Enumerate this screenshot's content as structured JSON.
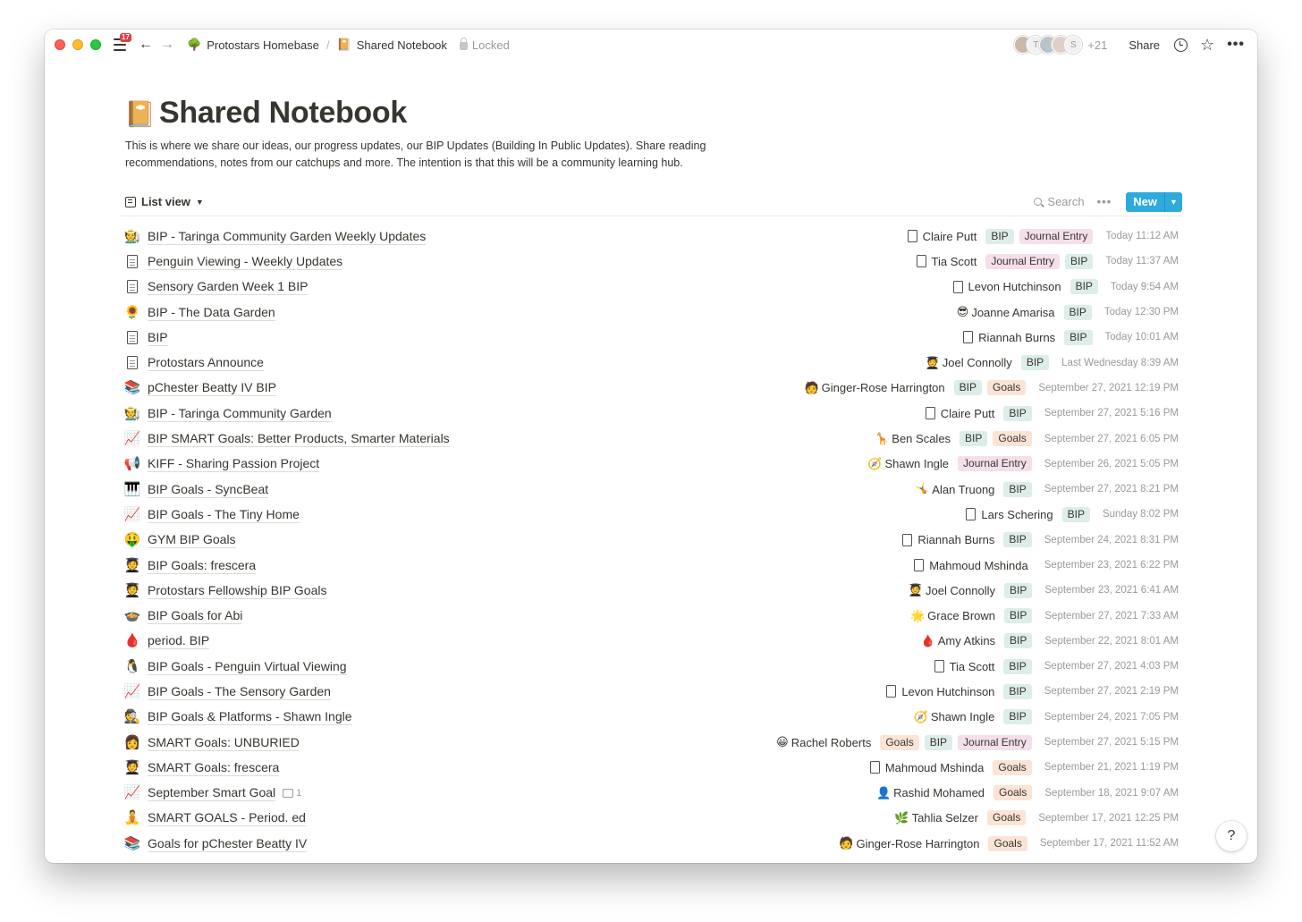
{
  "window": {
    "notification_count": "17",
    "breadcrumb": [
      {
        "icon": "🌳",
        "label": "Protostars Homebase"
      },
      {
        "icon": "📔",
        "label": "Shared Notebook"
      }
    ],
    "locked_label": "Locked",
    "avatar_letters": [
      "T",
      "S"
    ],
    "more_collaborators": "+21",
    "share_label": "Share",
    "help_label": "?"
  },
  "page": {
    "icon": "📔",
    "title": "Shared Notebook",
    "description": "This is where we share our ideas, our progress updates, our BIP Updates (Building In Public Updates). Share reading recommendations, notes from our catchups and more. The intention is that this will be a community learning hub."
  },
  "view": {
    "label": "List view",
    "search_label": "Search",
    "new_label": "New"
  },
  "rows": [
    {
      "icon": "🧑‍🌾",
      "title": "BIP - Taringa Community Garden Weekly Updates",
      "person_icon": "doc",
      "person": "Claire Putt",
      "tags": [
        "BIP",
        "Journal Entry"
      ],
      "date": "Today 11:12 AM"
    },
    {
      "icon": "doc",
      "title": "Penguin Viewing - Weekly Updates",
      "person_icon": "doc",
      "person": "Tia Scott",
      "tags": [
        "Journal Entry",
        "BIP"
      ],
      "date": "Today 11:37 AM"
    },
    {
      "icon": "doc",
      "title": "Sensory Garden Week 1 BIP",
      "person_icon": "doc",
      "person": "Levon Hutchinson",
      "tags": [
        "BIP"
      ],
      "date": "Today 9:54 AM"
    },
    {
      "icon": "🌻",
      "title": "BIP - The Data Garden",
      "person_icon": "😎",
      "person": "Joanne Amarisa",
      "tags": [
        "BIP"
      ],
      "date": "Today 12:30 PM"
    },
    {
      "icon": "doc",
      "title": "BIP",
      "person_icon": "doc",
      "person": "Riannah Burns",
      "tags": [
        "BIP"
      ],
      "date": "Today 10:01 AM"
    },
    {
      "icon": "doc",
      "title": "Protostars Announce",
      "person_icon": "🧑‍🎓",
      "person": "Joel Connolly",
      "tags": [
        "BIP"
      ],
      "date": "Last Wednesday 8:39 AM"
    },
    {
      "icon": "📚",
      "title": "pChester Beatty IV BIP",
      "person_icon": "🧑",
      "person": "Ginger-Rose Harrington",
      "tags": [
        "BIP",
        "Goals"
      ],
      "date": "September 27, 2021 12:19 PM"
    },
    {
      "icon": "🧑‍🌾",
      "title": "BIP - Taringa Community Garden",
      "person_icon": "doc",
      "person": "Claire Putt",
      "tags": [
        "BIP"
      ],
      "date": "September 27, 2021 5:16 PM"
    },
    {
      "icon": "📈",
      "title": "BIP SMART Goals: Better Products, Smarter Materials",
      "person_icon": "🦒",
      "person": "Ben Scales",
      "tags": [
        "BIP",
        "Goals"
      ],
      "date": "September 27, 2021 6:05 PM"
    },
    {
      "icon": "📢",
      "title": "KIFF - Sharing Passion Project",
      "person_icon": "🧭",
      "person": "Shawn Ingle",
      "tags": [
        "Journal Entry"
      ],
      "date": "September 26, 2021 5:05 PM"
    },
    {
      "icon": "🎹",
      "title": "BIP Goals - SyncBeat",
      "person_icon": "🤸",
      "person": "Alan Truong",
      "tags": [
        "BIP"
      ],
      "date": "September 27, 2021 8:21 PM"
    },
    {
      "icon": "📈",
      "title": "BIP Goals - The Tiny Home",
      "person_icon": "doc",
      "person": "Lars Schering",
      "tags": [
        "BIP"
      ],
      "date": "Sunday 8:02 PM"
    },
    {
      "icon": "🤑",
      "title": "GYM BIP Goals",
      "person_icon": "doc",
      "person": "Riannah Burns",
      "tags": [
        "BIP"
      ],
      "date": "September 24, 2021 8:31 PM"
    },
    {
      "icon": "🧑‍🎓",
      "title": "BIP Goals: frescera",
      "person_icon": "doc",
      "person": "Mahmoud Mshinda",
      "tags": [],
      "date": "September 23, 2021 6:22 PM"
    },
    {
      "icon": "🧑‍🎓",
      "title": "Protostars Fellowship BIP Goals",
      "person_icon": "🧑‍🎓",
      "person": "Joel Connolly",
      "tags": [
        "BIP"
      ],
      "date": "September 23, 2021 6:41 AM"
    },
    {
      "icon": "🍲",
      "title": "BIP Goals for Abi",
      "person_icon": "🌟",
      "person": "Grace Brown",
      "tags": [
        "BIP"
      ],
      "date": "September 27, 2021 7:33 AM"
    },
    {
      "icon": "🩸",
      "title": "period. BIP",
      "person_icon": "🩸",
      "person": "Amy Atkins",
      "tags": [
        "BIP"
      ],
      "date": "September 22, 2021 8:01 AM"
    },
    {
      "icon": "🐧",
      "title": "BIP Goals - Penguin Virtual Viewing",
      "person_icon": "doc",
      "person": "Tia Scott",
      "tags": [
        "BIP"
      ],
      "date": "September 27, 2021 4:03 PM"
    },
    {
      "icon": "📈",
      "title": "BIP Goals - The Sensory Garden",
      "person_icon": "doc",
      "person": "Levon Hutchinson",
      "tags": [
        "BIP"
      ],
      "date": "September 27, 2021 2:19 PM"
    },
    {
      "icon": "🕵️",
      "title": "BIP Goals & Platforms - Shawn Ingle",
      "person_icon": "🧭",
      "person": "Shawn Ingle",
      "tags": [
        "BIP"
      ],
      "date": "September 24, 2021 7:05 PM"
    },
    {
      "icon": "👩",
      "title": "SMART Goals: UNBURIED",
      "person_icon": "😀",
      "person": "Rachel Roberts",
      "tags": [
        "Goals",
        "BIP",
        "Journal Entry"
      ],
      "date": "September 27, 2021 5:15 PM"
    },
    {
      "icon": "🧑‍🎓",
      "title": "SMART Goals: frescera",
      "person_icon": "doc",
      "person": "Mahmoud Mshinda",
      "tags": [
        "Goals"
      ],
      "date": "September 21, 2021 1:19 PM"
    },
    {
      "icon": "📈",
      "title": "September Smart Goal",
      "comments": "1",
      "person_icon": "👤",
      "person": "Rashid Mohamed",
      "tags": [
        "Goals"
      ],
      "date": "September 18, 2021 9:07 AM"
    },
    {
      "icon": "🧘",
      "title": "SMART GOALS - Period. ed",
      "person_icon": "🌿",
      "person": "Tahlia Selzer",
      "tags": [
        "Goals"
      ],
      "date": "September 17, 2021 12:25 PM"
    },
    {
      "icon": "📚",
      "title": "Goals for pChester Beatty IV",
      "person_icon": "🧑",
      "person": "Ginger-Rose Harrington",
      "tags": [
        "Goals"
      ],
      "date": "September 17, 2021 11:52 AM"
    }
  ]
}
